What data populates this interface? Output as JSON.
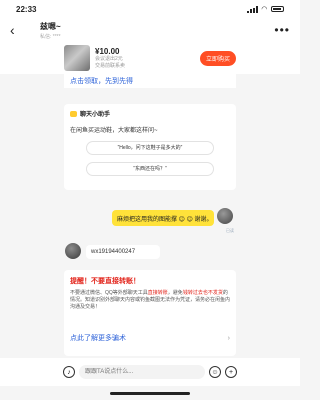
{
  "status": {
    "time": "22:33"
  },
  "header": {
    "title": "兹嗯~",
    "subtitle": "私信: ****"
  },
  "product": {
    "price": "¥10.00",
    "line1": "会议退出2元",
    "line2": "交易前联系卖",
    "buy_label": "立即购买"
  },
  "tip": "点击领取，先到先得",
  "assistant": {
    "title": "聊天小助手",
    "question": "在闲鱼买运动鞋，大家都这样问~",
    "suggestions": [
      "“Hello，问下这鞋子是多大的”",
      "“东西还在吗？”"
    ]
  },
  "messages": {
    "mine": "麻烦把这用我的图能撑 😊 😊 谢谢。",
    "read_status": "已读",
    "theirs": "wx19194400247"
  },
  "warning": {
    "title": "提醒！不要直接转账！",
    "p1": "不要通过微信、QQ等外部聊天工具",
    "p1_red": "直接转账",
    "p2": "，避免",
    "p2_red": "钱转过去也不发货",
    "p3": "的情况。知道识别外部聊天内容或钓鱼截图无法作为凭证，请务必在闲鱼内沟通及交易！",
    "link": "点此了解更多骗术"
  },
  "input": {
    "placeholder": "跟跟TA说点什么..."
  }
}
